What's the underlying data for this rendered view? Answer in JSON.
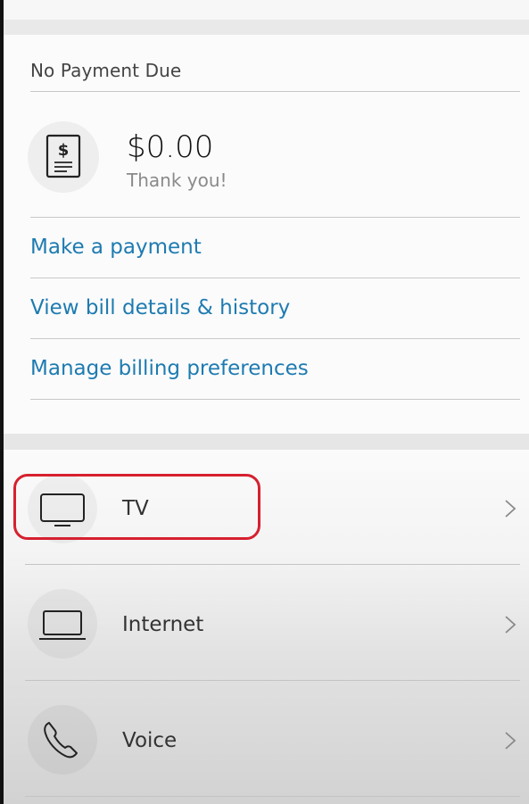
{
  "billing": {
    "title": "No Payment Due",
    "amount": "$0.00",
    "message": "Thank you!",
    "icon": "bill-document-icon",
    "links": [
      {
        "label": "Make a payment"
      },
      {
        "label": "View bill details & history"
      },
      {
        "label": "Manage billing preferences"
      }
    ]
  },
  "services": [
    {
      "label": "TV",
      "icon": "tv-icon"
    },
    {
      "label": "Internet",
      "icon": "laptop-icon"
    },
    {
      "label": "Voice",
      "icon": "phone-icon"
    }
  ],
  "colors": {
    "link": "#1e7bb0",
    "highlight": "#d6202f"
  }
}
